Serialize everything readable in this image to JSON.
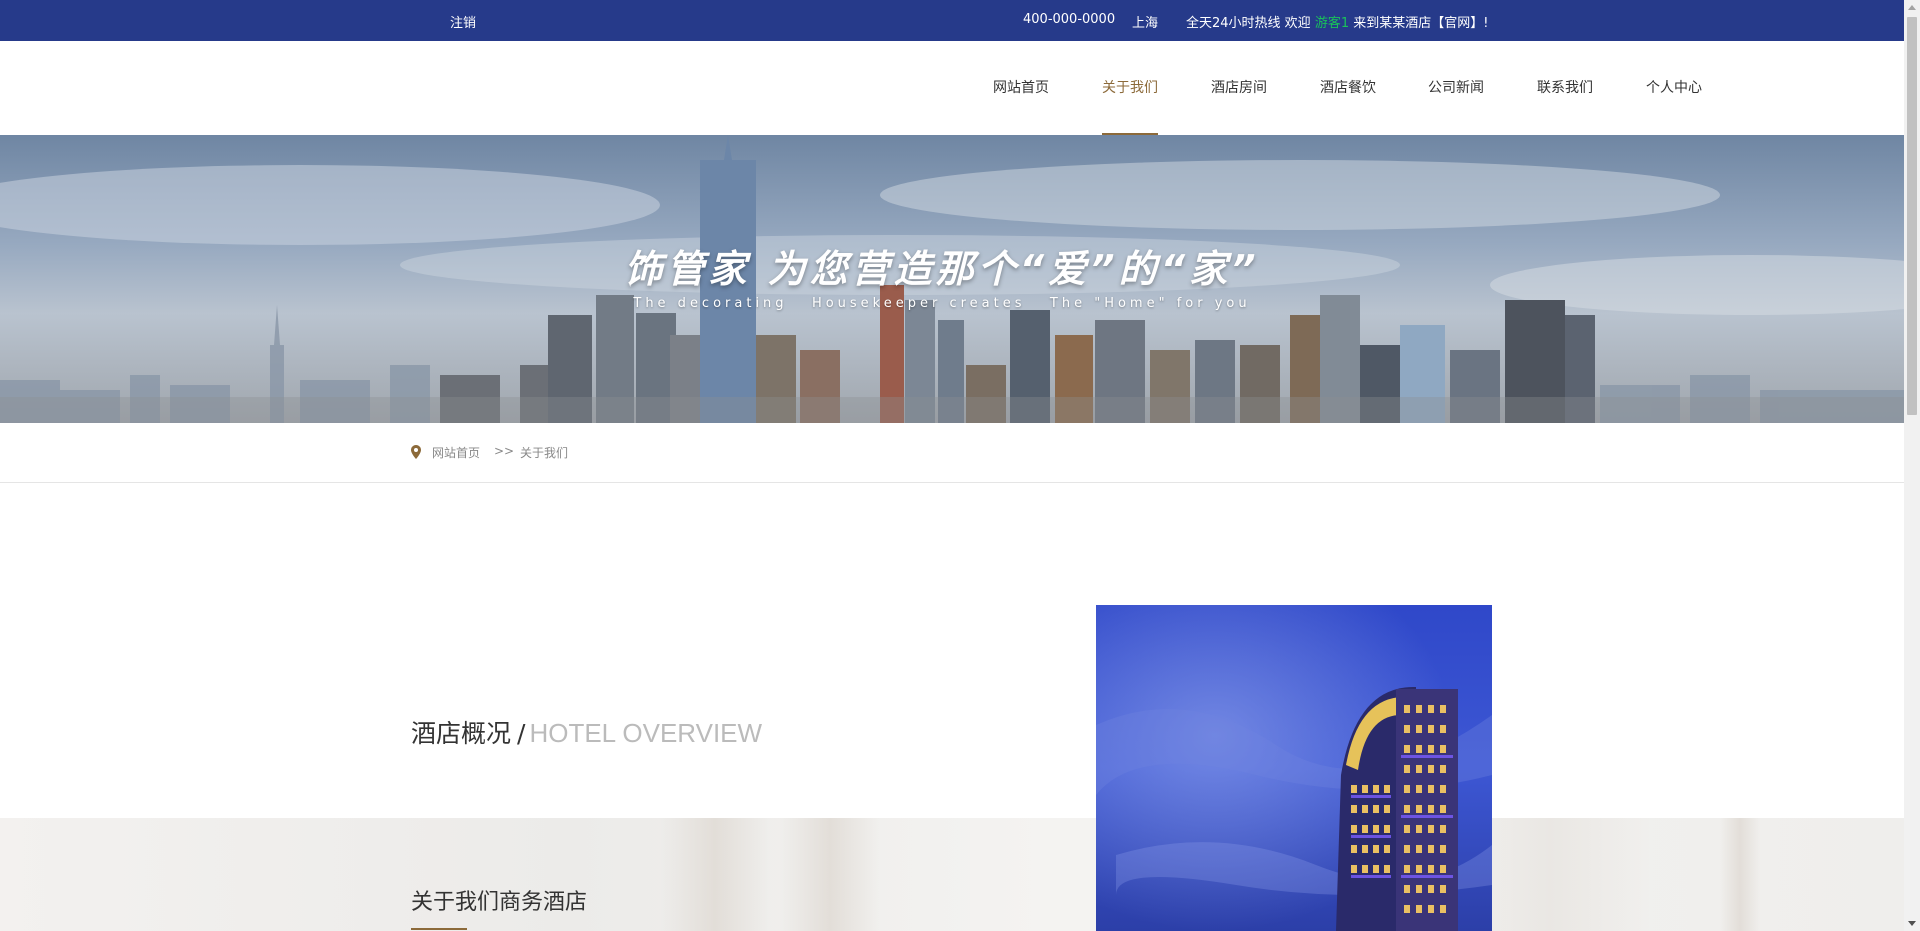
{
  "topbar": {
    "logout": "注销",
    "phone": "400-000-0000",
    "city": "上海",
    "welcome_prefix": "全天24小时热线  欢迎 ",
    "username": "游客1",
    "welcome_suffix": " 来到某某酒店【官网】!"
  },
  "nav": {
    "items": [
      {
        "label": "网站首页",
        "active": false
      },
      {
        "label": "关于我们",
        "active": true
      },
      {
        "label": "酒店房间",
        "active": false
      },
      {
        "label": "酒店餐饮",
        "active": false
      },
      {
        "label": "公司新闻",
        "active": false
      },
      {
        "label": "联系我们",
        "active": false
      },
      {
        "label": "个人中心",
        "active": false
      }
    ]
  },
  "banner": {
    "title": "饰管家 为您营造那个“爱”的“家”",
    "subtitle": "The decorating   Housekeeper creates   The \"Home\" for you"
  },
  "breadcrumb": {
    "home": "网站首页",
    "separator": ">>",
    "current": "关于我们"
  },
  "overview": {
    "title_cn": "酒店概况",
    "slash": "/",
    "title_en": "HOTEL OVERVIEW"
  },
  "about": {
    "title": "关于我们商务酒店"
  },
  "colors": {
    "topbar_bg": "#263a8a",
    "accent_gold": "#8c6a3a",
    "username_green": "#19c25a"
  },
  "icons": {
    "breadcrumb": "location-pin-icon"
  }
}
